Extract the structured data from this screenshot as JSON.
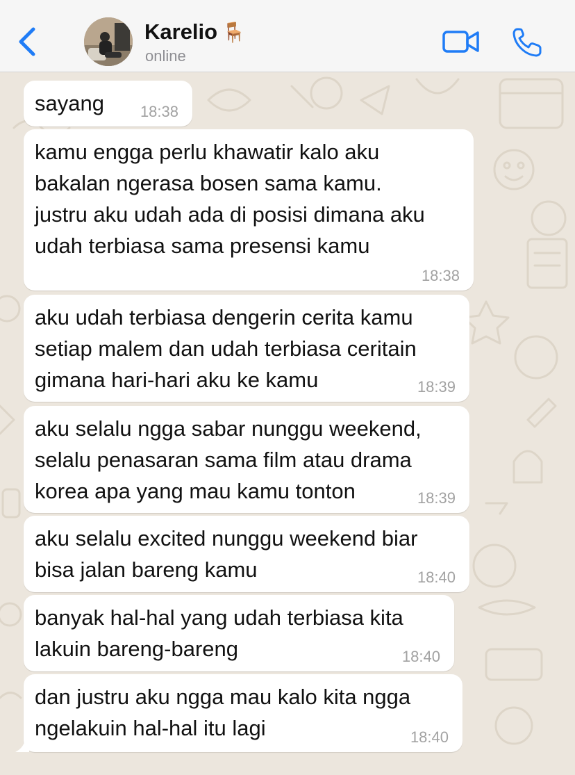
{
  "header": {
    "contact_name": "Karelio",
    "name_emoji": "🪑",
    "status": "online",
    "accent_color": "#1f7cf6"
  },
  "icons": {
    "back": "chevron-left-icon",
    "video": "video-camera-icon",
    "call": "phone-icon"
  },
  "messages": [
    {
      "text": "sayang",
      "time": "18:38"
    },
    {
      "text": "kamu engga perlu khawatir kalo aku\nbakalan ngerasa bosen sama kamu.\njustru aku udah ada di posisi dimana aku\nudah terbiasa sama presensi kamu",
      "time": "18:38"
    },
    {
      "text": "aku udah terbiasa dengerin cerita kamu\nsetiap malem dan udah terbiasa ceritain\ngimana hari-hari aku ke kamu",
      "time": "18:39"
    },
    {
      "text": "aku selalu ngga sabar nunggu weekend,\nselalu penasaran sama film atau drama\nkorea apa yang mau kamu tonton",
      "time": "18:39"
    },
    {
      "text": "aku selalu excited nunggu weekend biar\nbisa jalan bareng kamu",
      "time": "18:40"
    },
    {
      "text": "banyak hal-hal yang udah terbiasa kita\nlakuin bareng-bareng",
      "time": "18:40"
    },
    {
      "text": "dan justru aku ngga mau kalo kita ngga\nngelakuin hal-hal itu lagi",
      "time": "18:40"
    }
  ]
}
